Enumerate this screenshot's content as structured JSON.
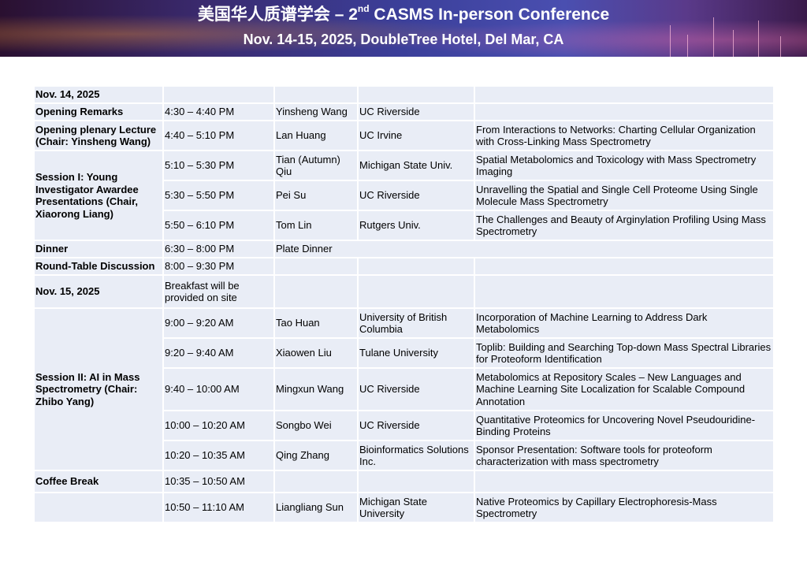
{
  "header": {
    "title_main": "美国华人质谱学会 – 2",
    "title_sup": "nd",
    "title_rest": " CASMS In-person Conference",
    "subtitle": "Nov. 14-15, 2025, DoubleTree Hotel, Del Mar, CA"
  },
  "schedule": {
    "day1": "Nov. 14, 2025",
    "opening_remarks": "Opening Remarks",
    "opening_remarks_time": "4:30 – 4:40 PM",
    "opening_remarks_speaker": "Yinsheng Wang",
    "opening_remarks_affil": "UC Riverside",
    "plenary": "Opening plenary Lecture (Chair: Yinsheng Wang)",
    "plenary_time": "4:40 – 5:10 PM",
    "plenary_speaker": "Lan Huang",
    "plenary_affil": "UC Irvine",
    "plenary_title": "From Interactions to Networks: Charting Cellular Organization with Cross-Linking Mass Spectrometry",
    "session1": "Session I: Young Investigator Awardee Presentations (Chair, Xiaorong Liang)",
    "session1_talks": [
      {
        "time": "5:10 – 5:30 PM",
        "speaker": "Tian (Autumn) Qiu",
        "affil": "Michigan State Univ.",
        "title": "Spatial Metabolomics and Toxicology with Mass Spectrometry Imaging"
      },
      {
        "time": "5:30 – 5:50 PM",
        "speaker": "Pei Su",
        "affil": "UC Riverside",
        "title": "Unravelling the Spatial and Single Cell Proteome Using Single Molecule Mass Spectrometry"
      },
      {
        "time": "5:50 – 6:10 PM",
        "speaker": "Tom Lin",
        "affil": "Rutgers Univ.",
        "title": "The Challenges and Beauty of Arginylation Profiling Using Mass Spectrometry"
      }
    ],
    "dinner": "Dinner",
    "dinner_time": "6:30 – 8:00 PM",
    "dinner_note": "Plate Dinner",
    "roundtable": "Round-Table Discussion",
    "roundtable_time": "8:00 – 9:30 PM",
    "day2": "Nov. 15, 2025",
    "breakfast": "Breakfast will be provided on site",
    "session2": "Session II: AI in Mass Spectrometry (Chair: Zhibo Yang)",
    "session2_talks": [
      {
        "time": "9:00 – 9:20 AM",
        "speaker": "Tao Huan",
        "affil": "University of British Columbia",
        "title": "Incorporation of Machine Learning to Address Dark Metabolomics"
      },
      {
        "time": "9:20 – 9:40 AM",
        "speaker": "Xiaowen Liu",
        "affil": "Tulane University",
        "title": "Toplib: Building and Searching Top-down Mass Spectral Libraries for Proteoform Identification"
      },
      {
        "time": "9:40 – 10:00 AM",
        "speaker": "Mingxun Wang",
        "affil": "UC Riverside",
        "title": "Metabolomics at Repository Scales – New Languages and Machine Learning Site Localization for Scalable Compound Annotation"
      },
      {
        "time": "10:00 – 10:20 AM",
        "speaker": "Songbo Wei",
        "affil": "UC Riverside",
        "title": "Quantitative Proteomics for Uncovering Novel Pseudouridine-Binding Proteins"
      },
      {
        "time": "10:20 – 10:35 AM",
        "speaker": "Qing Zhang",
        "affil": "Bioinformatics Solutions Inc.",
        "title": "Sponsor Presentation: Software tools for proteoform characterization with mass spectrometry"
      }
    ],
    "coffee": "Coffee Break",
    "coffee_time": "10:35 – 10:50 AM",
    "last_talk": {
      "time": "10:50 – 11:10 AM",
      "speaker": "Liangliang Sun",
      "affil": "Michigan State University",
      "title": "Native Proteomics by Capillary Electrophoresis-Mass Spectrometry"
    }
  }
}
